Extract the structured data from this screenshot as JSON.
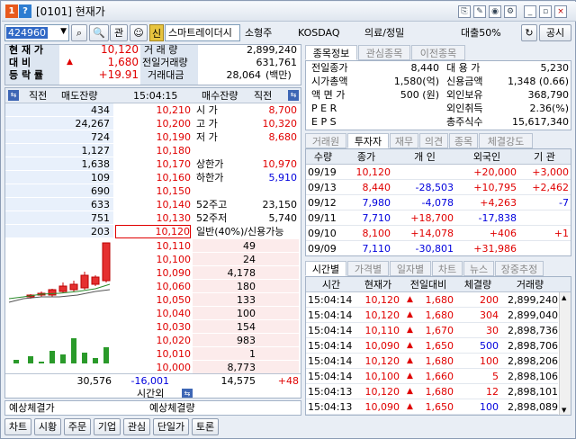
{
  "window": {
    "num1": "1",
    "num2": "?",
    "title": "[0101] 현재가"
  },
  "toolbar": {
    "code": "424960",
    "gwan": "관",
    "sin": "신",
    "stock_name": "스마트레이더시",
    "sector": "소형주",
    "market": "KOSDAQ",
    "industry": "의료/정밀",
    "loan": "대출50%",
    "notice_btn": "공시"
  },
  "summary": {
    "labels": [
      "현 재 가",
      "대    비",
      "등 락 률"
    ],
    "price": "10,120",
    "change_arrow": "▲",
    "change": "1,680",
    "rate": "+19.91",
    "vol_label": "거 래 량",
    "vol": "2,899,240",
    "prevvol_label": "전일거래량",
    "prevvol": "631,761",
    "amt_label": "거래대금",
    "amt": "28,064",
    "amt_unit": "(백만)"
  },
  "orderbook": {
    "header": {
      "left_prev": "직전",
      "sell_rem": "매도잔량",
      "time": "15:04:15",
      "buy_rem": "매수잔량",
      "right_prev": "직전"
    },
    "asks": [
      {
        "qty": "434",
        "price": "10,210",
        "info_label": "시  가",
        "info_val": "8,700",
        "info_color": "red"
      },
      {
        "qty": "24,267",
        "price": "10,200",
        "info_label": "고  가",
        "info_val": "10,320",
        "info_color": "red"
      },
      {
        "qty": "724",
        "price": "10,190",
        "info_label": "저  가",
        "info_val": "8,680",
        "info_color": "red"
      },
      {
        "qty": "1,127",
        "price": "10,180",
        "info_label": "",
        "info_val": "",
        "info_color": "red"
      },
      {
        "qty": "1,638",
        "price": "10,170",
        "info_label": "상한가",
        "info_val": "10,970",
        "info_color": "red"
      },
      {
        "qty": "109",
        "price": "10,160",
        "info_label": "하한가",
        "info_val": "5,910",
        "info_color": "blue"
      },
      {
        "qty": "690",
        "price": "10,150",
        "info_label": "",
        "info_val": "",
        "info_color": "red"
      },
      {
        "qty": "633",
        "price": "10,140",
        "info_label": "52주고",
        "info_val": "23,150",
        "info_color": "black"
      },
      {
        "qty": "751",
        "price": "10,130",
        "info_label": "52주저",
        "info_val": "5,740",
        "info_color": "black"
      },
      {
        "qty": "203",
        "price": "10,120",
        "info_label": "일반(40%)/신용가능",
        "info_val": "",
        "info_color": "black"
      }
    ],
    "bids": [
      {
        "price": "10,110",
        "qty": "49"
      },
      {
        "price": "10,100",
        "qty": "24"
      },
      {
        "price": "10,090",
        "qty": "4,178"
      },
      {
        "price": "10,060",
        "qty": "180"
      },
      {
        "price": "10,050",
        "qty": "133"
      },
      {
        "price": "10,040",
        "qty": "100"
      },
      {
        "price": "10,030",
        "qty": "154"
      },
      {
        "price": "10,020",
        "qty": "983"
      },
      {
        "price": "10,010",
        "qty": "1"
      },
      {
        "price": "10,000",
        "qty": "8,773"
      }
    ],
    "totals": {
      "sell": "30,576",
      "diff": "-16,001",
      "buy": "14,575",
      "extra": "+48",
      "after": "시간외"
    },
    "expected": {
      "price_label": "예상체결가",
      "qty_label": "예상체결량"
    }
  },
  "info_tabs": [
    "종목정보",
    "관심종목",
    "이전종목"
  ],
  "info": {
    "left": [
      [
        "전일종가",
        "8,440"
      ],
      [
        "시가총액",
        "1,580(억)"
      ],
      [
        "액 면 가",
        "500 (원)"
      ],
      [
        "P E R",
        ""
      ],
      [
        "E P S",
        ""
      ]
    ],
    "right": [
      [
        "대 용 가",
        "5,230"
      ],
      [
        "신용금액",
        "1,348  (0.66)"
      ],
      [
        "외인보유",
        "368,790"
      ],
      [
        "외인취득",
        "2.36(%)"
      ],
      [
        "총주식수",
        "15,617,340"
      ]
    ]
  },
  "investor_tabs": [
    "거래원",
    "투자자",
    "재무",
    "의견",
    "종목",
    "체결강도"
  ],
  "investor": {
    "headers": [
      "수량",
      "종가",
      "개 인",
      "외국인",
      "기 관"
    ],
    "rows": [
      [
        "09/19",
        "10,120",
        "",
        "+20,000",
        "+3,000"
      ],
      [
        "09/13",
        "8,440",
        "-28,503",
        "+10,795",
        "+2,462"
      ],
      [
        "09/12",
        "7,980",
        "-4,078",
        "+4,263",
        "-7"
      ],
      [
        "09/11",
        "7,710",
        "+18,700",
        "-17,838",
        ""
      ],
      [
        "09/10",
        "8,100",
        "+14,078",
        "+406",
        "+1"
      ],
      [
        "09/09",
        "7,110",
        "-30,801",
        "+31,986",
        ""
      ]
    ]
  },
  "trades_tabs": [
    "시간별",
    "가격별",
    "일자별",
    "차트",
    "뉴스",
    "장중추정"
  ],
  "trades": {
    "headers": [
      "시간",
      "현재가",
      "전일대비",
      "체결량",
      "거래량"
    ],
    "rows": [
      [
        "15:04:14",
        "10,120",
        "1,680",
        "200",
        "2,899,240"
      ],
      [
        "15:04:14",
        "10,120",
        "1,680",
        "304",
        "2,899,040"
      ],
      [
        "15:04:14",
        "10,110",
        "1,670",
        "30",
        "2,898,736"
      ],
      [
        "15:04:14",
        "10,090",
        "1,650",
        "500",
        "2,898,706"
      ],
      [
        "15:04:14",
        "10,120",
        "1,680",
        "100",
        "2,898,206"
      ],
      [
        "15:04:14",
        "10,100",
        "1,660",
        "5",
        "2,898,106"
      ],
      [
        "15:04:13",
        "10,120",
        "1,680",
        "12",
        "2,898,101"
      ],
      [
        "15:04:13",
        "10,090",
        "1,650",
        "100",
        "2,898,089"
      ]
    ]
  },
  "bottom_buttons": [
    "차트",
    "시황",
    "주문",
    "기업",
    "관심",
    "단일가",
    "토론"
  ],
  "colors": {
    "up": "#e00000",
    "down": "#0000dd",
    "ask_bg": "#e8f0fb",
    "bid_bg": "#fcebeb"
  }
}
